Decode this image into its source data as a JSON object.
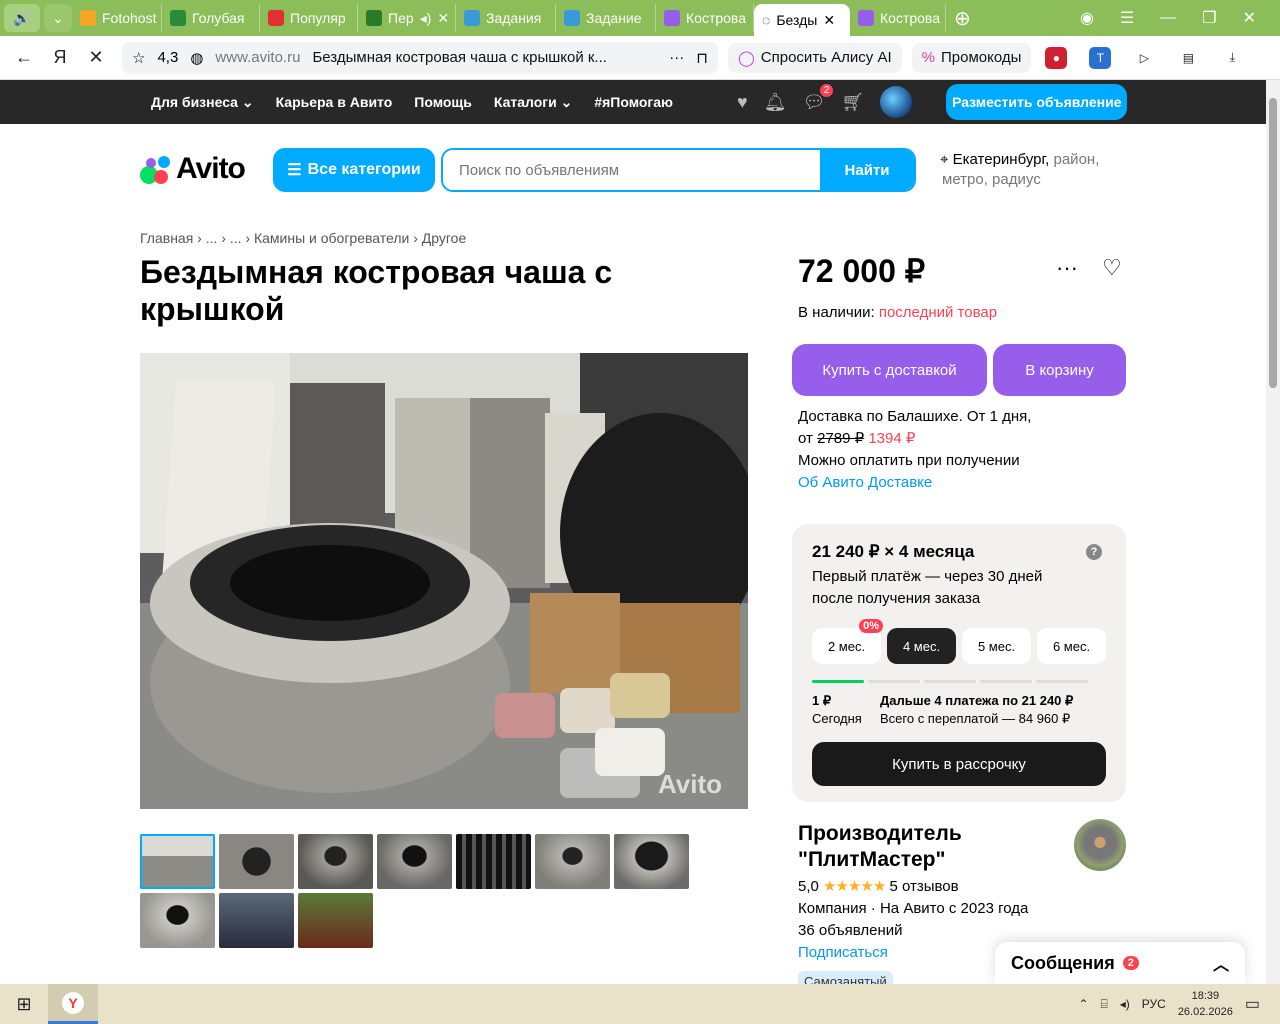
{
  "browser": {
    "tabs": [
      {
        "label": "",
        "icon": "sound-icon"
      },
      {
        "label": "Fotohost",
        "icon": "fotohost-icon",
        "color": "#f5a623"
      },
      {
        "label": "Голубая",
        "icon": "hd-icon",
        "color": "#2a8a3a"
      },
      {
        "label": "Популяр",
        "icon": "sound-muted-icon",
        "color": "#e03030"
      },
      {
        "label": "Пер",
        "icon": "green-site-icon",
        "color": "#2a7a2a"
      },
      {
        "label": "Задания",
        "icon": "sp-icon",
        "color": "#3a9ad8"
      },
      {
        "label": "Задание",
        "icon": "sp-icon",
        "color": "#3a9ad8"
      },
      {
        "label": "Кострова",
        "icon": "avito-icon",
        "color": "#965eeb"
      },
      {
        "label": "Безды",
        "icon": "loading-icon",
        "active": true
      },
      {
        "label": "Кострова",
        "icon": "avito-icon",
        "color": "#965eeb"
      }
    ],
    "address": {
      "rating": "4,3",
      "url": "www.avito.ru",
      "title": "Бездымная костровая чаша с крышкой к..."
    },
    "alice_label": "Спросить Алису AI",
    "promo_label": "Промокоды"
  },
  "topnav": {
    "links": [
      "Для бизнеса ⌄",
      "Карьера в Авито",
      "Помощь",
      "Каталоги ⌄",
      "#яПомогаю"
    ],
    "messages_badge": "2",
    "post_button": "Разместить объявление"
  },
  "header": {
    "logo": "Avito",
    "all_categories": "Все категории",
    "search_placeholder": "Поиск по объявлениям",
    "search_button": "Найти",
    "location_city": "Екатеринбург,",
    "location_hint1": "район,",
    "location_hint2": "метро, радиус"
  },
  "breadcrumbs": "Главная › ... › ... › Камины и обогреватели › Другое",
  "listing": {
    "title": "Бездымная костровая чаша с крышкой",
    "price": "72 000 ₽",
    "stock_label": "В наличии:",
    "stock_value": "последний товар",
    "buy_delivery": "Купить с доставкой",
    "to_cart": "В корзину",
    "delivery_line1": "Доставка по Балашихе. От 1 дня,",
    "delivery_from": "от",
    "delivery_old": "2789 ₽",
    "delivery_new": "1394 ₽",
    "pay_on_receipt": "Можно оплатить при получении",
    "about_delivery": "Об Авито Доставке",
    "watermark": "Avito"
  },
  "installment": {
    "headline": "21 240 ₽ × 4 месяца",
    "help": "?",
    "subtitle": "Первый платёж — через 30 дней после получения заказа",
    "terms": [
      "2 мес.",
      "4 мес.",
      "5 мес.",
      "6 мес."
    ],
    "selected_term": "4 мес.",
    "zero_badge": "0%",
    "first_amount": "1 ₽",
    "first_when": "Сегодня",
    "next_payments": "Дальше 4 платежа по 21 240 ₽",
    "total": "Всего с переплатой — 84 960 ₽",
    "buy_button": "Купить в рассрочку"
  },
  "seller": {
    "name": "Производитель \"ПлитМастер\"",
    "rating": "5,0",
    "stars": "★★★★★",
    "reviews": "5 отзывов",
    "type": "Компания · На Авито с 2023 года",
    "ads": "36 объявлений",
    "subscribe": "Подписаться",
    "self_employed": "Самозанятый"
  },
  "messages_widget": {
    "label": "Сообщения",
    "count": "2"
  },
  "taskbar": {
    "lang": "РУС",
    "time": "18:39",
    "date": "26.02.2026"
  },
  "colors": {
    "brand_blue": "#00aaff",
    "purple": "#965eeb",
    "red": "#ff4053",
    "green": "#02d15c"
  }
}
